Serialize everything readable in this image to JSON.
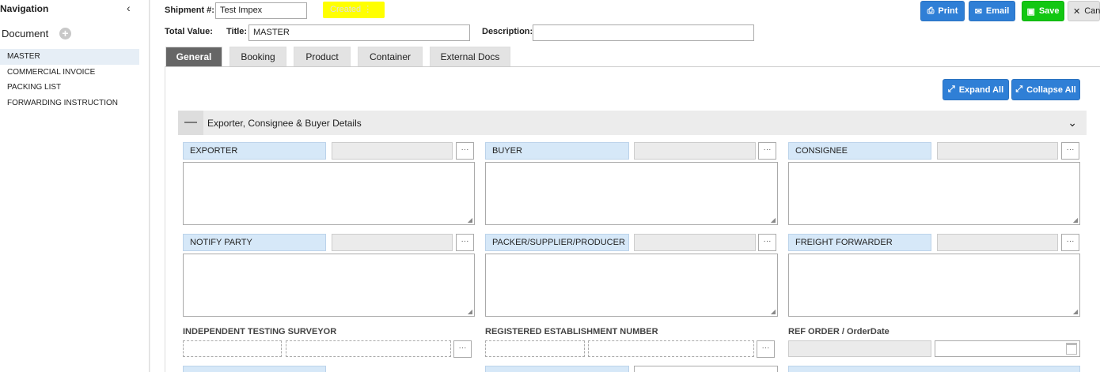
{
  "sidebar": {
    "title": "Navigation",
    "document_label": "Document",
    "add_symbol": "+",
    "documents": [
      "MASTER",
      "COMMERCIAL INVOICE",
      "PACKING LIST",
      "FORWARDING INSTRUCTION"
    ]
  },
  "header": {
    "shipment_label": "Shipment #:",
    "shipment_value": "Test Impex",
    "status": "Created",
    "total_value_label": "Total Value:",
    "title_label": "Title:",
    "title_value": "MASTER",
    "description_label": "Description:",
    "description_value": ""
  },
  "toolbar": {
    "print": "Print",
    "email": "Email",
    "save": "Save",
    "cancel": "Can"
  },
  "tabs": [
    "General",
    "Booking",
    "Product",
    "Container",
    "External Docs"
  ],
  "panel": {
    "expand_all": "Expand All",
    "collapse_all": "Collapse All",
    "section_title": "Exporter, Consignee & Buyer Details",
    "toggle_symbol": "—",
    "parties": {
      "exporter": "EXPORTER",
      "buyer": "BUYER",
      "consignee": "CONSIGNEE",
      "notify_party": "NOTIFY PARTY",
      "packer": "PACKER/SUPPLIER/PRODUCER",
      "freight_forwarder": "FREIGHT FORWARDER"
    },
    "dots": "···",
    "independent_testing": "INDEPENDENT TESTING SURVEYOR",
    "registered_establishment": "REGISTERED ESTABLISHMENT NUMBER",
    "ref_order": "REF ORDER / OrderDate"
  },
  "colors": {
    "accent_blue": "#2f7fd6",
    "save_green": "#12c712",
    "status_yellow": "#ffff00",
    "label_blue": "#d6e8f8"
  }
}
